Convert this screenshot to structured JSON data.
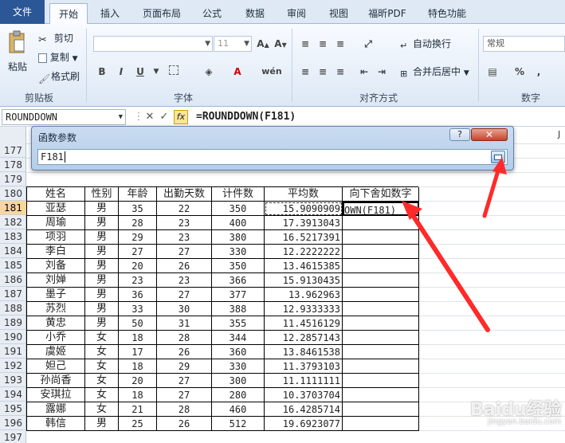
{
  "ribbon_tabs": [
    "文件",
    "开始",
    "插入",
    "页面布局",
    "公式",
    "数据",
    "审阅",
    "视图",
    "福昕PDF",
    "特色功能"
  ],
  "clipboard": {
    "paste": "粘贴",
    "cut": "剪切",
    "copy": "复制",
    "format_painter": "格式刷",
    "label": "剪贴板"
  },
  "font": {
    "size": "11",
    "label": "字体",
    "bold": "B",
    "italic": "I",
    "underline": "U",
    "color_a": "A",
    "wen": "wén"
  },
  "alignment": {
    "wrap": "自动换行",
    "merge": "合并后居中",
    "label": "对齐方式"
  },
  "number": {
    "format": "常规",
    "label": "数字",
    "percent": "%",
    "comma": ","
  },
  "formula_bar": {
    "name_box": "ROUNDDOWN",
    "fx": "fx",
    "formula": "=ROUNDDOWN(F181)"
  },
  "dialog": {
    "title": "函数参数",
    "help": "?",
    "close": "✕",
    "input_value": "F181"
  },
  "column_j": "J",
  "row_numbers": [
    "177",
    "178",
    "179",
    "180",
    "181",
    "182",
    "183",
    "184",
    "185",
    "186",
    "187",
    "188",
    "189",
    "190",
    "191",
    "192",
    "193",
    "194",
    "195",
    "196",
    "197"
  ],
  "table": {
    "headers": [
      "姓名",
      "性别",
      "年龄",
      "出勤天数",
      "计件数",
      "平均数",
      "向下舍如数字"
    ],
    "rows": [
      [
        "亚瑟",
        "男",
        "35",
        "22",
        "350",
        "15.9090909",
        "OWN(F181)"
      ],
      [
        "周瑜",
        "男",
        "28",
        "23",
        "400",
        "17.3913043",
        ""
      ],
      [
        "项羽",
        "男",
        "29",
        "23",
        "380",
        "16.5217391",
        ""
      ],
      [
        "李白",
        "男",
        "27",
        "27",
        "330",
        "12.2222222",
        ""
      ],
      [
        "刘备",
        "男",
        "20",
        "26",
        "350",
        "13.4615385",
        ""
      ],
      [
        "刘婵",
        "男",
        "23",
        "23",
        "366",
        "15.9130435",
        ""
      ],
      [
        "墨子",
        "男",
        "36",
        "27",
        "377",
        "13.962963",
        ""
      ],
      [
        "苏烈",
        "男",
        "33",
        "30",
        "388",
        "12.9333333",
        ""
      ],
      [
        "黄忠",
        "男",
        "50",
        "31",
        "355",
        "11.4516129",
        ""
      ],
      [
        "小乔",
        "女",
        "18",
        "28",
        "344",
        "12.2857143",
        ""
      ],
      [
        "虞姬",
        "女",
        "17",
        "26",
        "360",
        "13.8461538",
        ""
      ],
      [
        "妲己",
        "女",
        "18",
        "29",
        "330",
        "11.3793103",
        ""
      ],
      [
        "孙尚香",
        "女",
        "20",
        "27",
        "300",
        "11.1111111",
        ""
      ],
      [
        "安琪拉",
        "女",
        "18",
        "27",
        "280",
        "10.3703704",
        ""
      ],
      [
        "露娜",
        "女",
        "21",
        "28",
        "460",
        "16.4285714",
        ""
      ],
      [
        "韩信",
        "男",
        "25",
        "26",
        "512",
        "19.6923077",
        ""
      ]
    ]
  },
  "watermark": {
    "brand": "Baidu经验",
    "url": "jingyan.baidu.com"
  },
  "accent": {
    "file_tab": "#2b5797",
    "arrow": "#ff2a2a",
    "selected_row": "#f7d79b"
  }
}
